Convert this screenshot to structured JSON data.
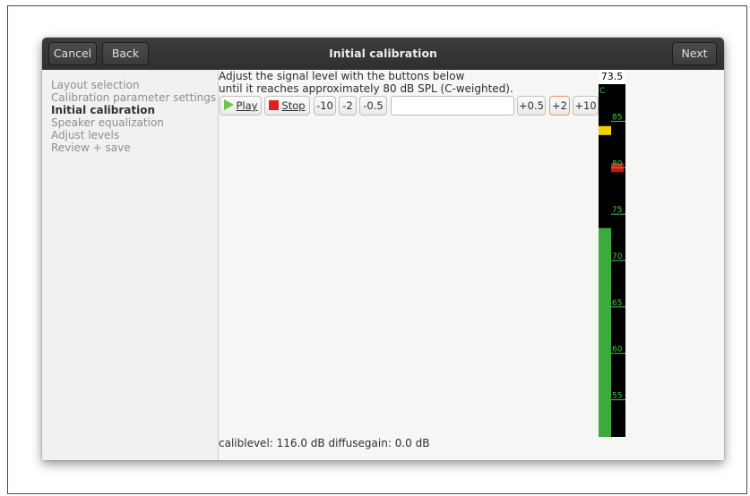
{
  "window": {
    "title": "Initial calibration",
    "cancel_label": "Cancel",
    "back_label": "Back",
    "next_label": "Next"
  },
  "sidebar": {
    "items": [
      {
        "label": "Layout selection"
      },
      {
        "label": "Calibration parameter settings"
      },
      {
        "label": "Initial calibration"
      },
      {
        "label": "Speaker equalization"
      },
      {
        "label": "Adjust levels"
      },
      {
        "label": "Review + save"
      }
    ],
    "active_index": 2
  },
  "main": {
    "instruction_line1": "Adjust the signal level with the buttons below",
    "instruction_line2": "until it reaches approximately 80 dB SPL (C-weighted).",
    "play_label": "Play",
    "stop_label": "Stop",
    "minus10": "-10",
    "minus2": "-2",
    "minus05": "-0.5",
    "entry_value": "",
    "plus05": "+0.5",
    "plus2": "+2",
    "plus10": "+10",
    "status_text": "caliblevel: 116.0 dB diffusegain: 0.0 dB"
  },
  "meter": {
    "readout": "73.5",
    "weighting_label": "C",
    "level_db": 73.5,
    "peak_db": 84,
    "target_db": 80,
    "scale_max_db": 89,
    "scale_min_db": 51,
    "ticks": [
      85,
      80,
      75,
      70,
      65,
      60,
      55
    ],
    "colors": {
      "bar": "#3daa3d",
      "peak": "#f0d000",
      "target": "#d01010",
      "tick": "#46c846",
      "background": "#000000"
    }
  }
}
